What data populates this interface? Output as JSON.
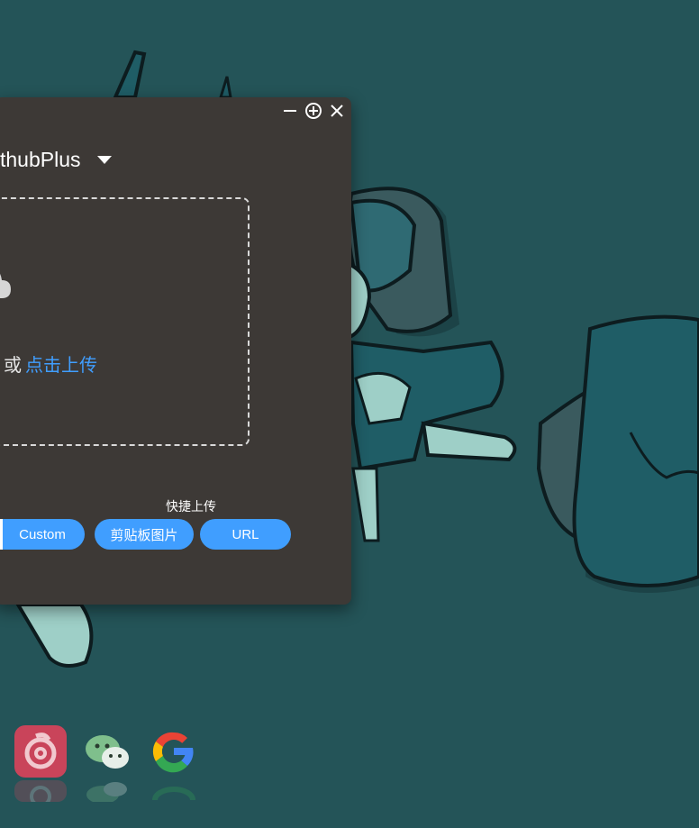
{
  "window": {
    "controls": {
      "minimize_icon": "minimize-icon",
      "maximize_icon": "plus-circle-icon",
      "close_icon": "close-icon"
    },
    "picbed_selector": {
      "label": "thubPlus",
      "icon": "caret-down-icon"
    },
    "dropzone": {
      "icon": "cloud-upload-icon",
      "text_prefix": "处，或",
      "link_text": "点击上传"
    },
    "quick_upload": {
      "label": "快捷上传",
      "buttons": [
        {
          "label": "Custom"
        },
        {
          "label": "剪贴板图片"
        },
        {
          "label": "URL"
        }
      ]
    }
  },
  "dock": {
    "apps": [
      {
        "name": "netease-music-icon"
      },
      {
        "name": "wechat-icon"
      },
      {
        "name": "google-icon"
      }
    ]
  },
  "colors": {
    "desktop_bg": "#245458",
    "window_bg": "#3d3936",
    "accent": "#409eff"
  }
}
